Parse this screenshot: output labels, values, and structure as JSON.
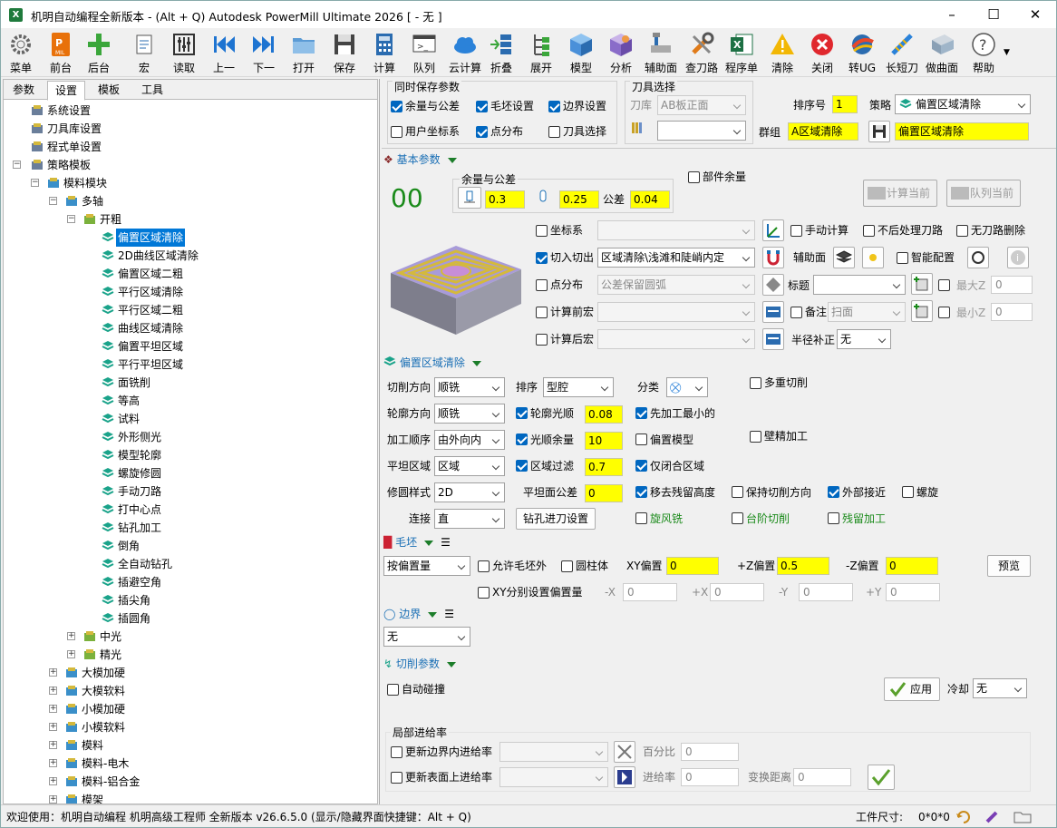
{
  "window": {
    "title": "机明自动编程全新版本 - (Alt + Q) Autodesk PowerMill Ultimate 2026   [ - 无 ]",
    "app_icon": "excel-like-icon"
  },
  "toolbar": [
    {
      "label": "菜单",
      "icon": "gear-icon"
    },
    {
      "label": "前台",
      "icon": "mil-icon"
    },
    {
      "label": "后台",
      "icon": "plus-icon"
    },
    {
      "label": "宏",
      "icon": "macro-icon"
    },
    {
      "label": "读取",
      "icon": "sliders-icon"
    },
    {
      "label": "上一",
      "icon": "prev-icon"
    },
    {
      "label": "下一",
      "icon": "next-icon"
    },
    {
      "label": "打开",
      "icon": "folder-icon"
    },
    {
      "label": "保存",
      "icon": "save-icon"
    },
    {
      "label": "计算",
      "icon": "calculator-icon"
    },
    {
      "label": "队列",
      "icon": "queue-icon"
    },
    {
      "label": "云计算",
      "icon": "cloud-icon"
    },
    {
      "label": "折叠",
      "icon": "collapse-icon"
    },
    {
      "label": "展开",
      "icon": "expand-icon"
    },
    {
      "label": "模型",
      "icon": "cube-icon"
    },
    {
      "label": "分析",
      "icon": "analyze-icon"
    },
    {
      "label": "辅助面",
      "icon": "aux-surface-icon"
    },
    {
      "label": "查刀路",
      "icon": "wrench-icon"
    },
    {
      "label": "程序单",
      "icon": "excel-icon"
    },
    {
      "label": "清除",
      "icon": "warning-icon"
    },
    {
      "label": "关闭",
      "icon": "close-circle-icon"
    },
    {
      "label": "转UG",
      "icon": "ug-icon"
    },
    {
      "label": "长短刀",
      "icon": "tool-length-icon"
    },
    {
      "label": "做曲面",
      "icon": "surface-icon"
    },
    {
      "label": "帮助",
      "icon": "help-icon"
    }
  ],
  "left_tabs": [
    "参数",
    "设置",
    "模板",
    "工具"
  ],
  "left_active_tab": "设置",
  "tree": [
    {
      "label": "系统设置",
      "level": 1
    },
    {
      "label": "刀具库设置",
      "level": 1
    },
    {
      "label": "程式单设置",
      "level": 1
    },
    {
      "label": "策略模板",
      "level": 1
    },
    {
      "label": "模料模块",
      "level": 2
    },
    {
      "label": "多轴",
      "level": 3
    },
    {
      "label": "开粗",
      "level": 4
    },
    {
      "label": "偏置区域清除",
      "level": 5,
      "selected": true
    },
    {
      "label": "2D曲线区域清除",
      "level": 5
    },
    {
      "label": "偏置区域二粗",
      "level": 5
    },
    {
      "label": "平行区域清除",
      "level": 5
    },
    {
      "label": "平行区域二粗",
      "level": 5
    },
    {
      "label": "曲线区域清除",
      "level": 5
    },
    {
      "label": "偏置平坦区域",
      "level": 5
    },
    {
      "label": "平行平坦区域",
      "level": 5
    },
    {
      "label": "面铣削",
      "level": 5
    },
    {
      "label": "等高",
      "level": 5
    },
    {
      "label": "试料",
      "level": 5
    },
    {
      "label": "外形侧光",
      "level": 5
    },
    {
      "label": "模型轮廓",
      "level": 5
    },
    {
      "label": "螺旋修圆",
      "level": 5
    },
    {
      "label": "手动刀路",
      "level": 5
    },
    {
      "label": "打中心点",
      "level": 5
    },
    {
      "label": "钻孔加工",
      "level": 5
    },
    {
      "label": "倒角",
      "level": 5
    },
    {
      "label": "全自动钻孔",
      "level": 5
    },
    {
      "label": "插避空角",
      "level": 5
    },
    {
      "label": "插尖角",
      "level": 5
    },
    {
      "label": "插圆角",
      "level": 5
    },
    {
      "label": "中光",
      "level": 4
    },
    {
      "label": "精光",
      "level": 4
    },
    {
      "label": "大模加硬",
      "level": 3
    },
    {
      "label": "大模软料",
      "level": 3
    },
    {
      "label": "小模加硬",
      "level": 3
    },
    {
      "label": "小模软料",
      "level": 3
    },
    {
      "label": "模料",
      "level": 3
    },
    {
      "label": "模料-电木",
      "level": 3
    },
    {
      "label": "模料-铝合金",
      "level": 3
    },
    {
      "label": "模架",
      "level": 3
    }
  ],
  "save_group": {
    "title": "同时保存参数",
    "items": [
      {
        "label": "余量与公差",
        "checked": true
      },
      {
        "label": "毛坯设置",
        "checked": true
      },
      {
        "label": "边界设置",
        "checked": true
      },
      {
        "label": "用户坐标系",
        "checked": false
      },
      {
        "label": "点分布",
        "checked": true
      },
      {
        "label": "刀具选择",
        "checked": false
      }
    ]
  },
  "tool_group": {
    "title": "刀具选择",
    "lib_label": "刀库",
    "lib_value": "AB板正面"
  },
  "header": {
    "seq_label": "排序号",
    "seq_value": "1",
    "strategy_label": "策略",
    "strategy_value": "偏置区域清除",
    "group_label": "群组",
    "group_value": "A区域清除",
    "name_value": "偏置区域清除"
  },
  "basic": {
    "title": "基本参数",
    "counter": "00",
    "tol_title": "余量与公差",
    "stock": "0.3",
    "axial": "0.25",
    "tol_label": "公差",
    "tol": "0.04",
    "part_stock": "部件余量",
    "calc_btn": "计算当前",
    "queue_btn": "队列当前",
    "rows": [
      {
        "label": "坐标系",
        "checked": false,
        "value": ""
      },
      {
        "label": "切入切出",
        "checked": true,
        "value": "区域清除\\浅滩和陡峭内定"
      },
      {
        "label": "点分布",
        "checked": false,
        "value": "公差保留圆弧"
      },
      {
        "label": "计算前宏",
        "checked": false,
        "value": ""
      },
      {
        "label": "计算后宏",
        "checked": false,
        "value": ""
      }
    ],
    "manual_calc": "手动计算",
    "no_post": "不后处理刀路",
    "no_delete": "无刀路删除",
    "aux_surface": "辅助面",
    "smart": "智能配置",
    "title_label": "标题",
    "maxz": "最大Z",
    "maxz_val": "0",
    "note_label": "备注",
    "note_val": "扫面",
    "minz": "最小Z",
    "minz_val": "0",
    "radcomp_label": "半径补正",
    "radcomp_val": "无"
  },
  "offset": {
    "title": "偏置区域清除",
    "cut_dir_label": "切削方向",
    "cut_dir": "顺铣",
    "order_label": "排序",
    "order": "型腔",
    "class_label": "分类",
    "multi_cut": "多重切削",
    "profile_dir_label": "轮廓方向",
    "profile_dir": "顺铣",
    "profile_smooth": "轮廓光顺",
    "profile_smooth_val": "0.08",
    "first_small": "先加工最小的",
    "machining_order_label": "加工顺序",
    "machining_order": "由外向内",
    "smooth_stock": "光顺余量",
    "smooth_stock_val": "10",
    "offset_model": "偏置模型",
    "wall_finish": "壁精加工",
    "flat_label": "平坦区域",
    "flat": "区域",
    "region_filter": "区域过滤",
    "region_filter_val": "0.7",
    "closed_only": "仅闭合区域",
    "fillet_label": "修圆样式",
    "fillet": "2D",
    "flat_tol_label": "平坦面公差",
    "flat_tol": "0",
    "remove_rest": "移去残留高度",
    "keep_dir": "保持切削方向",
    "outer_approach": "外部接近",
    "spiral": "螺旋",
    "link_label": "连接",
    "link": "直",
    "drill_btn": "钻孔进刀设置",
    "trochoid": "旋风铣",
    "step_cut": "台阶切削",
    "rest": "残留加工"
  },
  "stock": {
    "title": "毛坯",
    "type": "按偏置量",
    "allow_out": "允许毛坯外",
    "cylinder": "圆柱体",
    "xy_label": "XY偏置",
    "xy": "0",
    "pz_label": "+Z偏置",
    "pz": "0.5",
    "nz_label": "-Z偏置",
    "nz": "0",
    "preview": "预览",
    "xy_sep": "XY分别设置偏置量",
    "mx": "-X",
    "mx_val": "0",
    "px": "+X",
    "px_val": "0",
    "my": "-Y",
    "my_val": "0",
    "py": "+Y",
    "py_val": "0"
  },
  "boundary": {
    "title": "边界",
    "value": "无"
  },
  "cutting": {
    "title": "切削参数",
    "auto_collision": "自动碰撞",
    "apply": "应用",
    "coolant_label": "冷却",
    "coolant": "无"
  },
  "feed": {
    "title": "局部进给率",
    "boundary_feed": "更新边界内进给率",
    "surface_feed": "更新表面上进给率",
    "pct_label": "百分比",
    "pct": "0",
    "feed_label": "进给率",
    "feed_val": "0",
    "dist_label": "变换距离",
    "dist": "0"
  },
  "status": {
    "text": "欢迎使用：机明自动编程 机明高级工程师 全新版本 v26.6.5.0  (显示/隐藏界面快捷键：Alt + Q)",
    "size_label": "工件尺寸:",
    "size": "0*0*0"
  }
}
